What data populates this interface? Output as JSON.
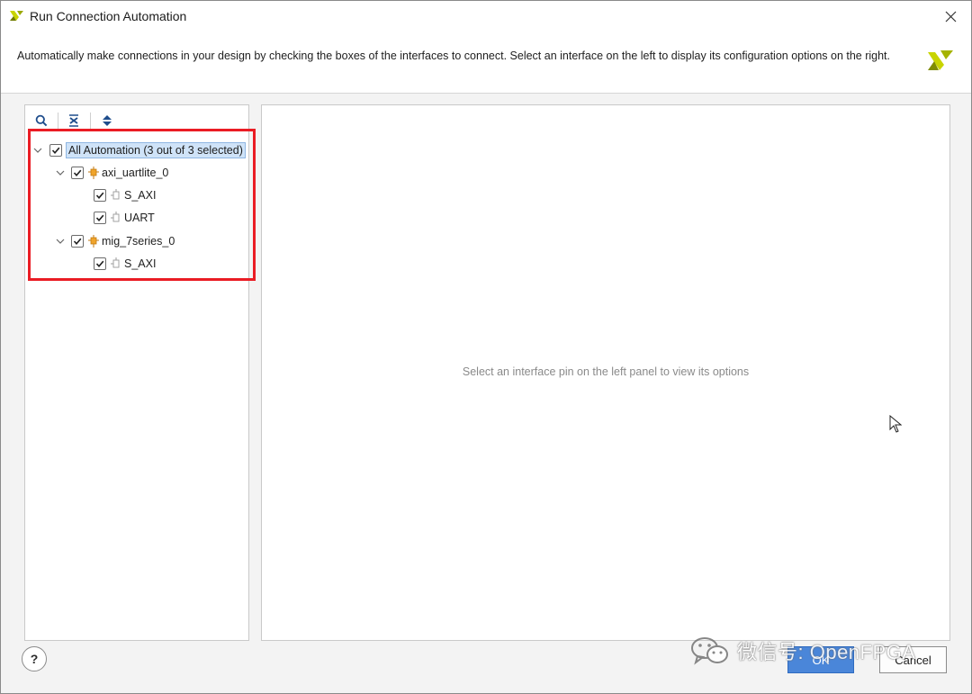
{
  "window": {
    "title": "Run Connection Automation",
    "description": "Automatically make connections in your design by checking the boxes of the interfaces to connect. Select an interface on the left to display its configuration options on the right."
  },
  "tree": {
    "root": {
      "label": "All Automation (3 out of 3 selected)",
      "checked": true,
      "expanded": true
    },
    "groups": [
      {
        "label": "axi_uartlite_0",
        "checked": true,
        "expanded": true,
        "children": [
          {
            "label": "S_AXI",
            "checked": true
          },
          {
            "label": "UART",
            "checked": true
          }
        ]
      },
      {
        "label": "mig_7series_0",
        "checked": true,
        "expanded": true,
        "children": [
          {
            "label": "S_AXI",
            "checked": true
          }
        ]
      }
    ]
  },
  "right_panel": {
    "placeholder": "Select an interface pin on the left panel to view its options"
  },
  "buttons": {
    "help": "?",
    "ok": "OK",
    "cancel": "Cancel"
  },
  "watermark": {
    "text": "微信号: OpenFPGA"
  },
  "colors": {
    "highlight": "#ea1c24",
    "ok_button": "#4a86d9",
    "selection": "#cfe3f8",
    "brand_yellow": "#c8d400"
  }
}
